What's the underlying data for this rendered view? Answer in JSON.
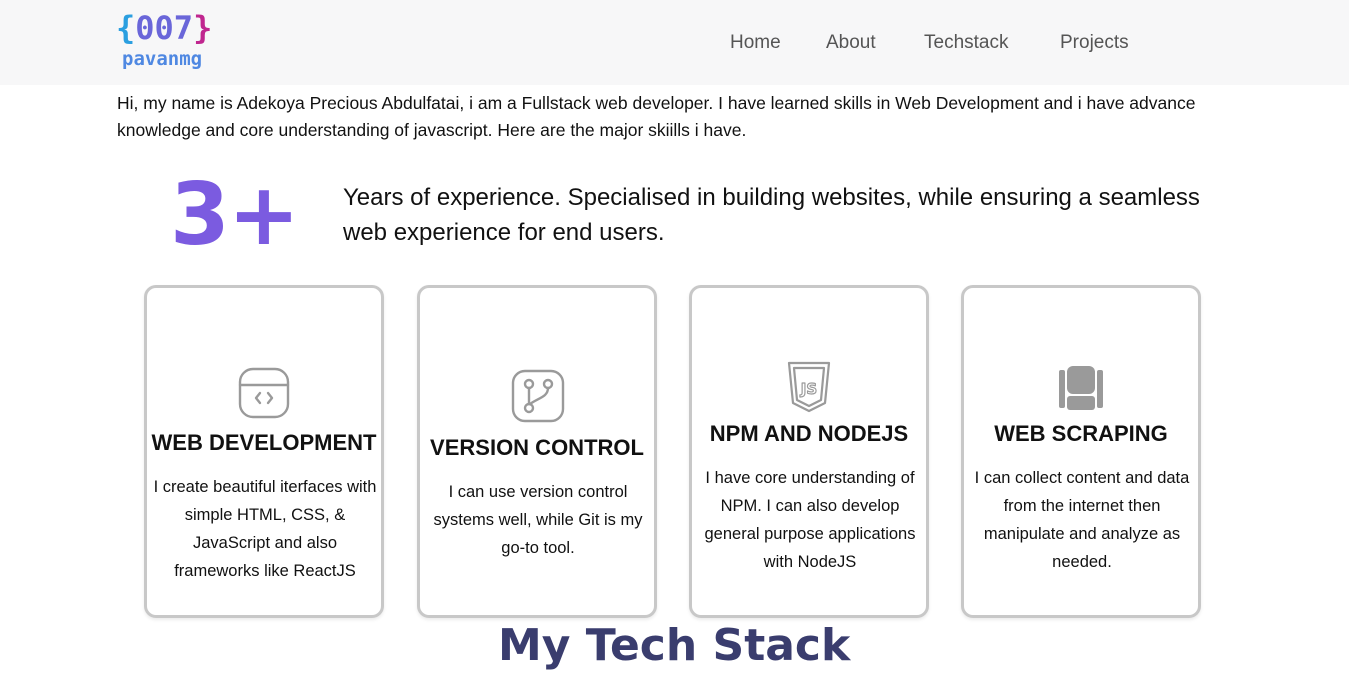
{
  "logo": {
    "brace_open": "{",
    "digits": "007",
    "brace_close": "}",
    "name": "pavanmg"
  },
  "nav": {
    "items": [
      {
        "label": "Home"
      },
      {
        "label": "About"
      },
      {
        "label": "Techstack"
      },
      {
        "label": "Projects"
      }
    ]
  },
  "intro": {
    "text": "Hi, my name is Adekoya Precious Abdulfatai, i am a Fullstack web developer. I have learned skills in Web Development and i have advance knowledge and core understanding of javascript. Here are the major skiills i have."
  },
  "experience": {
    "number": "3+",
    "text": "Years of experience. Specialised in building websites, while ensuring a seamless web experience for end users."
  },
  "cards": [
    {
      "icon": "code-window-icon",
      "title": "WEB DEVELOPMENT",
      "description": "I create beautiful iterfaces with simple HTML, CSS, & JavaScript and also frameworks like ReactJS"
    },
    {
      "icon": "git-branch-icon",
      "title": "VERSION CONTROL",
      "description": "I can use version control systems well, while Git is my go-to tool."
    },
    {
      "icon": "js-shield-icon",
      "title": "NPM AND NODEJS",
      "description": "I have core understanding of NPM. I can also develop general purpose applications with NodeJS"
    },
    {
      "icon": "scraper-icon",
      "title": "WEB SCRAPING",
      "description": "I can collect content and data from the internet then manipulate and analyze as needed."
    }
  ],
  "techstack": {
    "title": "My Tech Stack"
  },
  "colors": {
    "accent": "#7b5be0",
    "logo_blue": "#2b9fe0",
    "logo_purple": "#6a66d9",
    "logo_magenta": "#c0268f",
    "section_title": "#3a3d6e",
    "header_bg": "#f7f7f8"
  }
}
